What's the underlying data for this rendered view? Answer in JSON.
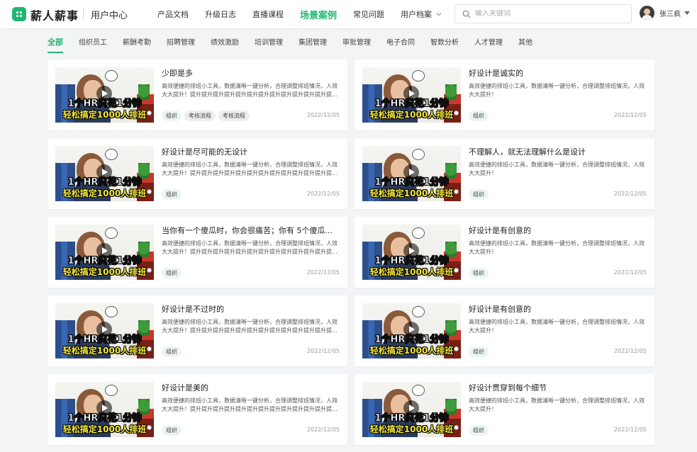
{
  "header": {
    "brand": "薪人薪事",
    "user_center": "用户中心",
    "nav": [
      {
        "label": "产品文档",
        "active": false,
        "dropdown": false
      },
      {
        "label": "升级日志",
        "active": false,
        "dropdown": false
      },
      {
        "label": "直播课程",
        "active": false,
        "dropdown": false
      },
      {
        "label": "场景案例",
        "active": true,
        "dropdown": false
      },
      {
        "label": "常见问题",
        "active": false,
        "dropdown": false
      },
      {
        "label": "用户档案",
        "active": false,
        "dropdown": true
      }
    ],
    "search_placeholder": "输入关键词",
    "username": "张三疯"
  },
  "tabs": [
    {
      "label": "全部",
      "active": true
    },
    {
      "label": "组织员工",
      "active": false
    },
    {
      "label": "薪酬考勤",
      "active": false
    },
    {
      "label": "招聘管理",
      "active": false
    },
    {
      "label": "绩效激励",
      "active": false
    },
    {
      "label": "培训管理",
      "active": false
    },
    {
      "label": "集团管理",
      "active": false
    },
    {
      "label": "审批管理",
      "active": false
    },
    {
      "label": "电子合同",
      "active": false
    },
    {
      "label": "智数分析",
      "active": false
    },
    {
      "label": "人才管理",
      "active": false
    },
    {
      "label": "其他",
      "active": false
    }
  ],
  "thumbnail": {
    "caption_line1": "1个HR只花1分钟",
    "caption_line2": "轻松搞定1000人排班"
  },
  "cards": [
    {
      "title": "少即是多",
      "desc": "高效便捷的排班小工具，数据清晰一键分析，合理调整排班情况，人效大大提升！提升提升提升提升提升提升提升提升提升提升提升提升提...",
      "tags": [
        "组织",
        "考核流程",
        "考核流程"
      ],
      "date": "2022/12/05"
    },
    {
      "title": "好设计是诚实的",
      "desc": "高效便捷的排班小工具，数据清晰一键分析，合理调整排班情况，人效大大提升！",
      "tags": [
        "组织"
      ],
      "date": "2022/12/05"
    },
    {
      "title": "好设计是尽可能的无设计",
      "desc": "高效便捷的排班小工具，数据清晰一键分析，合理调整排班情况，人效大大提升！提升提升提升提升提升提升提升提升提升提升提升提升提...",
      "tags": [
        "组织"
      ],
      "date": "2022/12/05"
    },
    {
      "title": "不理解人，就无法理解什么是设计",
      "desc": "高效便捷的排班小工具，数据清晰一键分析，合理调整排班情况，人效大大提升！",
      "tags": [
        "组织"
      ],
      "date": "2022/12/05"
    },
    {
      "title": "当你有一个傻瓜时，你会很痛苦；你有 5个傻瓜...",
      "desc": "高效便捷的排班小工具，数据清晰一键分析，合理调整排班情况，人效大大提升！提升提升提升提升提升提升提升提升提升提升提升提升提...",
      "tags": [
        "组织"
      ],
      "date": "2022/12/05"
    },
    {
      "title": "好设计是有创意的",
      "desc": "高效便捷的排班小工具，数据清晰一键分析，合理调整排班情况，人效大大提升！",
      "tags": [
        "组织"
      ],
      "date": "2022/12/05"
    },
    {
      "title": "好设计是不过时的",
      "desc": "高效便捷的排班小工具，数据清晰一键分析，合理调整排班情况，人效大大提升！提升提升提升提升提升提升提升提升提升提升提升提升提...",
      "tags": [
        "组织"
      ],
      "date": "2022/12/05"
    },
    {
      "title": "好设计是有创意的",
      "desc": "高效便捷的排班小工具，数据清晰一键分析，合理调整排班情况，人效大大提升！",
      "tags": [
        "组织"
      ],
      "date": "2022/12/05"
    },
    {
      "title": "好设计是美的",
      "desc": "高效便捷的排班小工具，数据清晰一键分析，合理调整排班情况，人效大大提升！提升提升提升提升提升提升提升提升提升提升提升提升提...",
      "tags": [
        "组织"
      ],
      "date": "2022/12/05"
    },
    {
      "title": "好设计贯穿到每个细节",
      "desc": "高效便捷的排班小工具，数据清晰一键分析，合理调整排班情况，人效大大提升！",
      "tags": [
        "组织"
      ],
      "date": "2022/12/05"
    }
  ],
  "colors": {
    "brand_green": "#21b573"
  }
}
